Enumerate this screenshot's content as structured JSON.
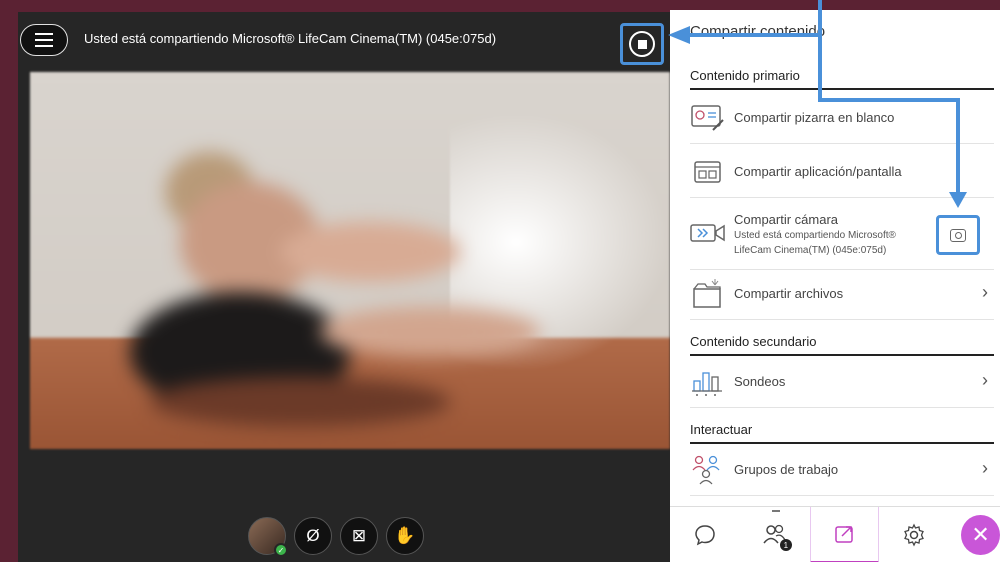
{
  "session": {
    "sharing_text": "Usted está compartiendo Microsoft® LifeCam Cinema(TM) (045e:075d)",
    "menu_icon": "hamburger-icon",
    "stop_icon": "stop-share-icon"
  },
  "controls": [
    {
      "name": "avatar",
      "icon": "avatar-icon"
    },
    {
      "name": "microphone",
      "icon": "mic-off-icon",
      "glyph": "Ø"
    },
    {
      "name": "camera",
      "icon": "camera-off-icon",
      "glyph": "⊠"
    },
    {
      "name": "raise-hand",
      "icon": "hand-icon",
      "glyph": "✋"
    }
  ],
  "panel": {
    "title": "Compartir contenido",
    "section_primary": "Contenido primario",
    "whiteboard": "Compartir pizarra en blanco",
    "app_screen": "Compartir aplicación/pantalla",
    "camera": "Compartir cámara",
    "camera_sub_1": "Usted está compartiendo Microsoft®",
    "camera_sub_2": "LifeCam Cinema(TM) (045e:075d)",
    "files": "Compartir archivos",
    "section_secondary": "Contenido secundario",
    "polls": "Sondeos",
    "section_interact": "Interactuar",
    "groups": "Grupos de trabajo"
  },
  "tabbar": {
    "participants_badge": "1"
  },
  "colors": {
    "accent_blue": "#4a90d9",
    "close_purple": "#c956d8",
    "background": "#5b2233"
  }
}
